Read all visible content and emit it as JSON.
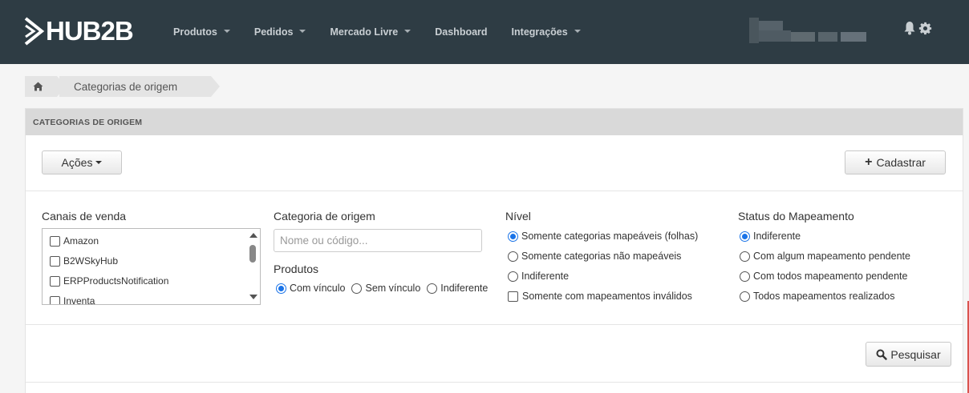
{
  "brand": {
    "name": "HUB2B"
  },
  "nav": {
    "items": [
      {
        "label": "Produtos",
        "dropdown": true
      },
      {
        "label": "Pedidos",
        "dropdown": true
      },
      {
        "label": "Mercado Livre",
        "dropdown": true
      },
      {
        "label": "Dashboard",
        "dropdown": false
      },
      {
        "label": "Integrações",
        "dropdown": true
      }
    ],
    "icons": [
      "bell-icon",
      "gear-icon"
    ]
  },
  "breadcrumb": {
    "current": "Categorias de origem",
    "home_icon": "home-icon"
  },
  "panel": {
    "heading": "CATEGORIAS DE ORIGEM",
    "actions_label": "Ações",
    "register_label": "Cadastrar",
    "search_label": "Pesquisar"
  },
  "filters": {
    "channels": {
      "title": "Canais de venda",
      "items": [
        "Amazon",
        "B2WSkyHub",
        "ERPProductsNotification",
        "Inventa"
      ]
    },
    "category": {
      "title": "Categoria de origem",
      "placeholder": "Nome ou código..."
    },
    "products": {
      "title": "Produtos",
      "options": [
        "Com vínculo",
        "Sem vínculo",
        "Indiferente"
      ],
      "selected": "Com vínculo"
    },
    "level": {
      "title": "Nível",
      "options": [
        "Somente categorias mapeáveis (folhas)",
        "Somente categorias não mapeáveis",
        "Indiferente"
      ],
      "selected": "Somente categorias mapeáveis (folhas)",
      "checkbox_label": "Somente com mapeamentos inválidos"
    },
    "mapping_status": {
      "title": "Status do Mapeamento",
      "options": [
        "Indiferente",
        "Com algum mapeamento pendente",
        "Com todos mapeamento pendente",
        "Todos mapeamentos realizados"
      ],
      "selected": "Indiferente"
    }
  },
  "colors": {
    "navbar": "#2e3c44",
    "accent": "#1a73e8",
    "panel_heading": "#d9d9d9"
  }
}
